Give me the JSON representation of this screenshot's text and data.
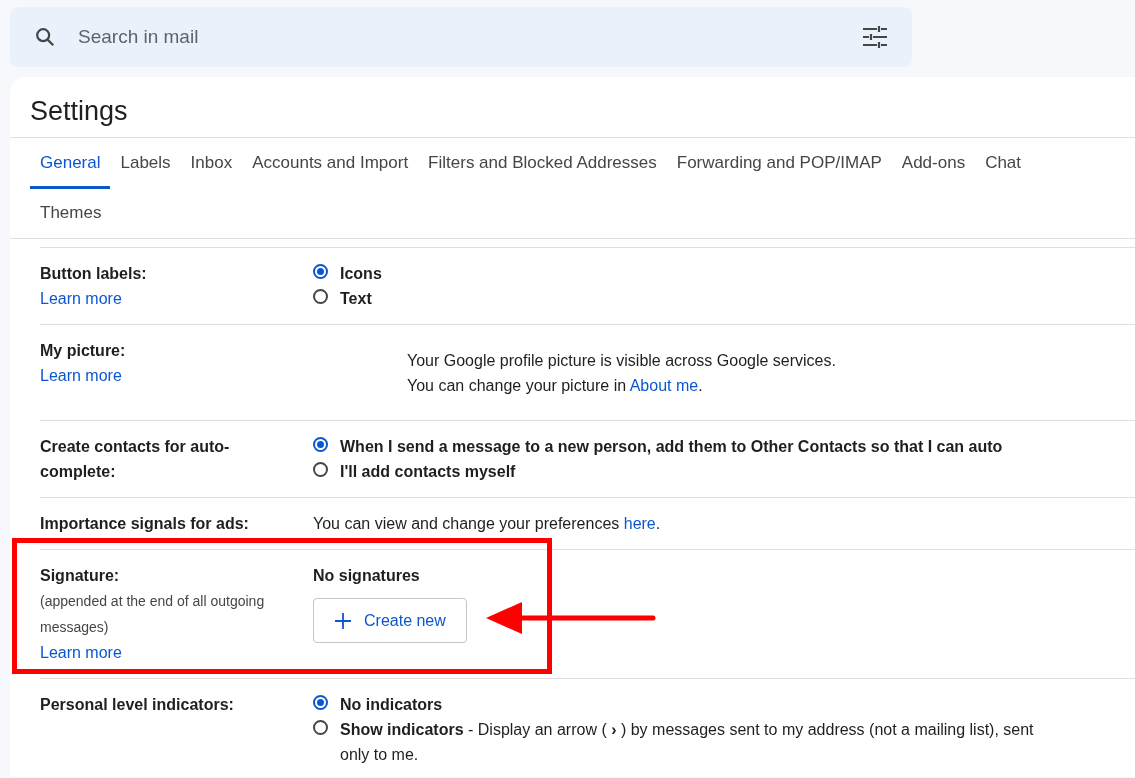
{
  "search": {
    "placeholder": "Search in mail"
  },
  "settings": {
    "title": "Settings",
    "tabs": [
      {
        "label": "General",
        "selected": true
      },
      {
        "label": "Labels",
        "selected": false
      },
      {
        "label": "Inbox",
        "selected": false
      },
      {
        "label": "Accounts and Import",
        "selected": false
      },
      {
        "label": "Filters and Blocked Addresses",
        "selected": false
      },
      {
        "label": "Forwarding and POP/IMAP",
        "selected": false
      },
      {
        "label": "Add-ons",
        "selected": false
      },
      {
        "label": "Chat",
        "selected": false
      },
      {
        "label": "Themes",
        "selected": false
      }
    ],
    "rows": [
      {
        "kind": "radio",
        "label": "Button labels:",
        "link": "Learn more",
        "options": [
          {
            "label": "Icons",
            "selected": true
          },
          {
            "label": "Text",
            "selected": false
          }
        ]
      },
      {
        "kind": "picture",
        "label": "My picture:",
        "link": "Learn more",
        "lines": [
          {
            "text": "Your Google profile picture is visible across Google services."
          },
          {
            "text": "You can change your picture in ",
            "link": "About me",
            "after": "."
          }
        ]
      },
      {
        "kind": "radio",
        "label": "Create contacts for auto-complete:",
        "options": [
          {
            "label": "When I send a message to a new person, add them to Other Contacts so that I can auto",
            "selected": true
          },
          {
            "label": "I'll add contacts myself",
            "selected": false
          }
        ]
      },
      {
        "kind": "text",
        "label": "Importance signals for ads:",
        "lines": [
          {
            "text": "You can view and change your preferences ",
            "link": "here",
            "after": "."
          }
        ]
      },
      {
        "kind": "signature",
        "label": "Signature:",
        "note": "(appended at the end of all outgoing messages)",
        "link": "Learn more",
        "heading": "No signatures",
        "button": "Create new"
      },
      {
        "kind": "radio",
        "label": "Personal level indicators:",
        "options": [
          {
            "label": "No indicators",
            "selected": true
          },
          {
            "label": "**Show indicators** - Display an arrow ( **›** ) by messages sent to my address (not a mailing list), sent only to me.",
            "selected": false
          }
        ]
      }
    ]
  }
}
